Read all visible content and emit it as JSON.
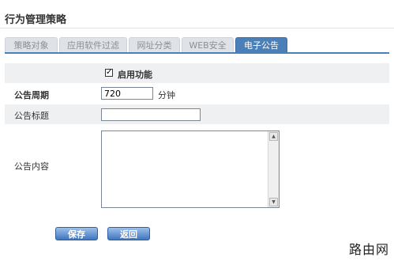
{
  "page": {
    "title": "行为管理策略"
  },
  "tabs": [
    {
      "label": "策略对象",
      "active": false
    },
    {
      "label": "应用软件过滤",
      "active": false
    },
    {
      "label": "网址分类",
      "active": false
    },
    {
      "label": "WEB安全",
      "active": false
    },
    {
      "label": "电子公告",
      "active": true
    }
  ],
  "form": {
    "enable": {
      "label": "启用功能",
      "checked": true,
      "check_glyph": "✓"
    },
    "period": {
      "label": "公告周期",
      "value": "720",
      "unit": "分钟"
    },
    "title": {
      "label": "公告标题",
      "value": ""
    },
    "content": {
      "label": "公告内容",
      "value": ""
    }
  },
  "buttons": {
    "save": "保存",
    "back": "返回"
  },
  "scroll": {
    "up_glyph": "▲",
    "down_glyph": "▼"
  },
  "watermark": "路由网",
  "colors": {
    "accent": "#4b7fb8",
    "row_grey": "#eef0f2"
  }
}
